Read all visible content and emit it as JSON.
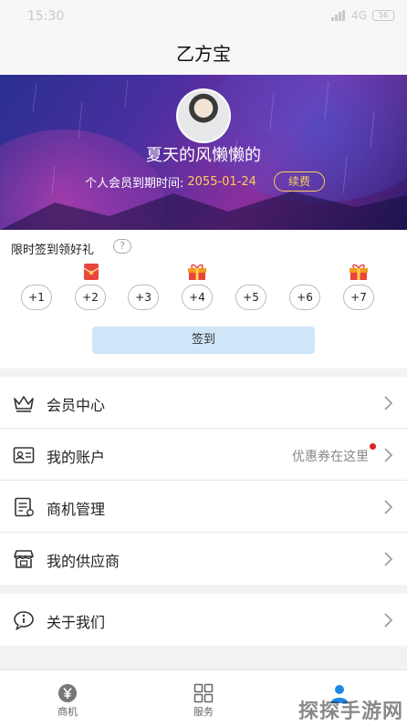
{
  "status_bar": {
    "time": "15:30",
    "network": "4G",
    "battery": "56"
  },
  "app": {
    "title": "乙方宝"
  },
  "profile": {
    "name": "夏天的风懒懒的",
    "expire_label": "个人会员到期时间:",
    "expire_date": "2055-01-24",
    "renew_label": "续费"
  },
  "signin": {
    "title": "限时签到领好礼",
    "help_label": "?",
    "days": [
      "+1",
      "+2",
      "+3",
      "+4",
      "+5",
      "+6",
      "+7"
    ],
    "button_label": "签到"
  },
  "menu": [
    {
      "label": "会员中心",
      "icon": "crown-icon"
    },
    {
      "label": "我的账户",
      "icon": "id-card-icon",
      "hint": "优惠券在这里"
    },
    {
      "label": "商机管理",
      "icon": "document-icon"
    },
    {
      "label": "我的供应商",
      "icon": "store-icon"
    }
  ],
  "menu2": [
    {
      "label": "关于我们",
      "icon": "info-bubble-icon"
    }
  ],
  "tabs": [
    {
      "label": "商机",
      "icon": "yen-icon"
    },
    {
      "label": "服务",
      "icon": "grid-icon"
    },
    {
      "label": "",
      "icon": "person-icon"
    }
  ],
  "watermark": "探探手游网",
  "colors": {
    "accent": "#1e88e5",
    "gold": "#ffcf5a",
    "gift_red": "#e8453c",
    "signin_button": "#cfe6f9"
  }
}
